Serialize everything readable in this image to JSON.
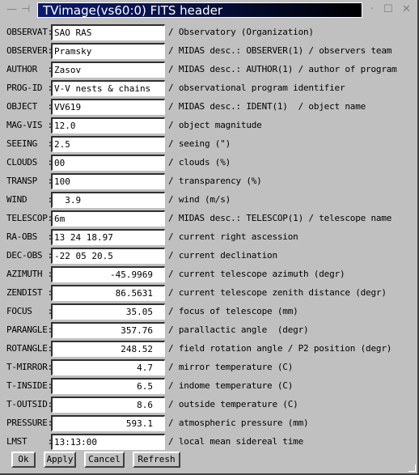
{
  "window": {
    "title": "TVimage(vs60:0) FITS header",
    "controls": {
      "menu": "—",
      "pin": "⊣",
      "minimize": "·",
      "maximize": "☐",
      "close": "✕"
    }
  },
  "fields": [
    {
      "label": "OBSERVAT:",
      "value": "SAO RAS",
      "align": "left",
      "desc": "/ Observatory (Organization)"
    },
    {
      "label": "OBSERVER:",
      "value": "Pramsky",
      "align": "left",
      "desc": "/ MIDAS desc.: OBSERVER(1) / observers team"
    },
    {
      "label": "AUTHOR  :",
      "value": "Zasov",
      "align": "left",
      "desc": "/ MIDAS desc.: AUTHOR(1) / author of program"
    },
    {
      "label": "PROG-ID :",
      "value": "V-V nests & chains",
      "align": "left",
      "desc": "/ observational program identifier"
    },
    {
      "label": "OBJECT  :",
      "value": "VV619",
      "align": "left",
      "desc": "/ MIDAS desc.: IDENT(1)  / object name"
    },
    {
      "label": "MAG-VIS :",
      "value": "12.0",
      "align": "left",
      "desc": "/ object magnitude"
    },
    {
      "label": "SEEING  :",
      "value": "2.5",
      "align": "left",
      "desc": "/ seeing (\")"
    },
    {
      "label": "CLOUDS  :",
      "value": "00",
      "align": "left",
      "desc": "/ clouds (%)"
    },
    {
      "label": "TRANSP  :",
      "value": "100",
      "align": "left",
      "desc": "/ transparency (%)"
    },
    {
      "label": "WIND    :",
      "value": "  3.9",
      "align": "left",
      "desc": "/ wind (m/s)"
    },
    {
      "label": "TELESCOP:",
      "value": "6m",
      "align": "left",
      "desc": "/ MIDAS desc.: TELESCOP(1) / telescope name"
    },
    {
      "label": "RA-OBS  :",
      "value": "13 24 18.97",
      "align": "left",
      "desc": "/ current right ascession"
    },
    {
      "label": "DEC-OBS :",
      "value": "-22 05 20.5",
      "align": "left",
      "desc": "/ current declination"
    },
    {
      "label": "AZIMUTH :",
      "value": "-45.9969",
      "align": "right",
      "desc": "/ current telescope azimuth (degr)"
    },
    {
      "label": "ZENDIST :",
      "value": "86.5631",
      "align": "right",
      "desc": "/ current telescope zenith distance (degr)"
    },
    {
      "label": "FOCUS   :",
      "value": "35.05",
      "align": "right",
      "desc": "/ focus of telescope (mm)"
    },
    {
      "label": "PARANGLE:",
      "value": "357.76",
      "align": "right",
      "desc": "/ parallactic angle  (degr)"
    },
    {
      "label": "ROTANGLE:",
      "value": "248.52",
      "align": "right",
      "desc": "/ field rotation angle / P2 position (degr)"
    },
    {
      "label": "T-MIRROR:",
      "value": "4.7",
      "align": "right",
      "desc": "/ mirror temperature (C)"
    },
    {
      "label": "T-INSIDE:",
      "value": "6.5",
      "align": "right",
      "desc": "/ indome temperature (C)"
    },
    {
      "label": "T-OUTSID:",
      "value": "8.6",
      "align": "right",
      "desc": "/ outside temperature (C)"
    },
    {
      "label": "PRESSURE:",
      "value": "593.1",
      "align": "right",
      "desc": "/ atmospheric pressure (mm)"
    },
    {
      "label": "LMST    :",
      "value": "13:13:00",
      "align": "left",
      "desc": "/ local mean sidereal time"
    }
  ],
  "buttons": {
    "ok": "Ok",
    "apply": "Apply",
    "cancel": "Cancel",
    "refresh": "Refresh"
  }
}
